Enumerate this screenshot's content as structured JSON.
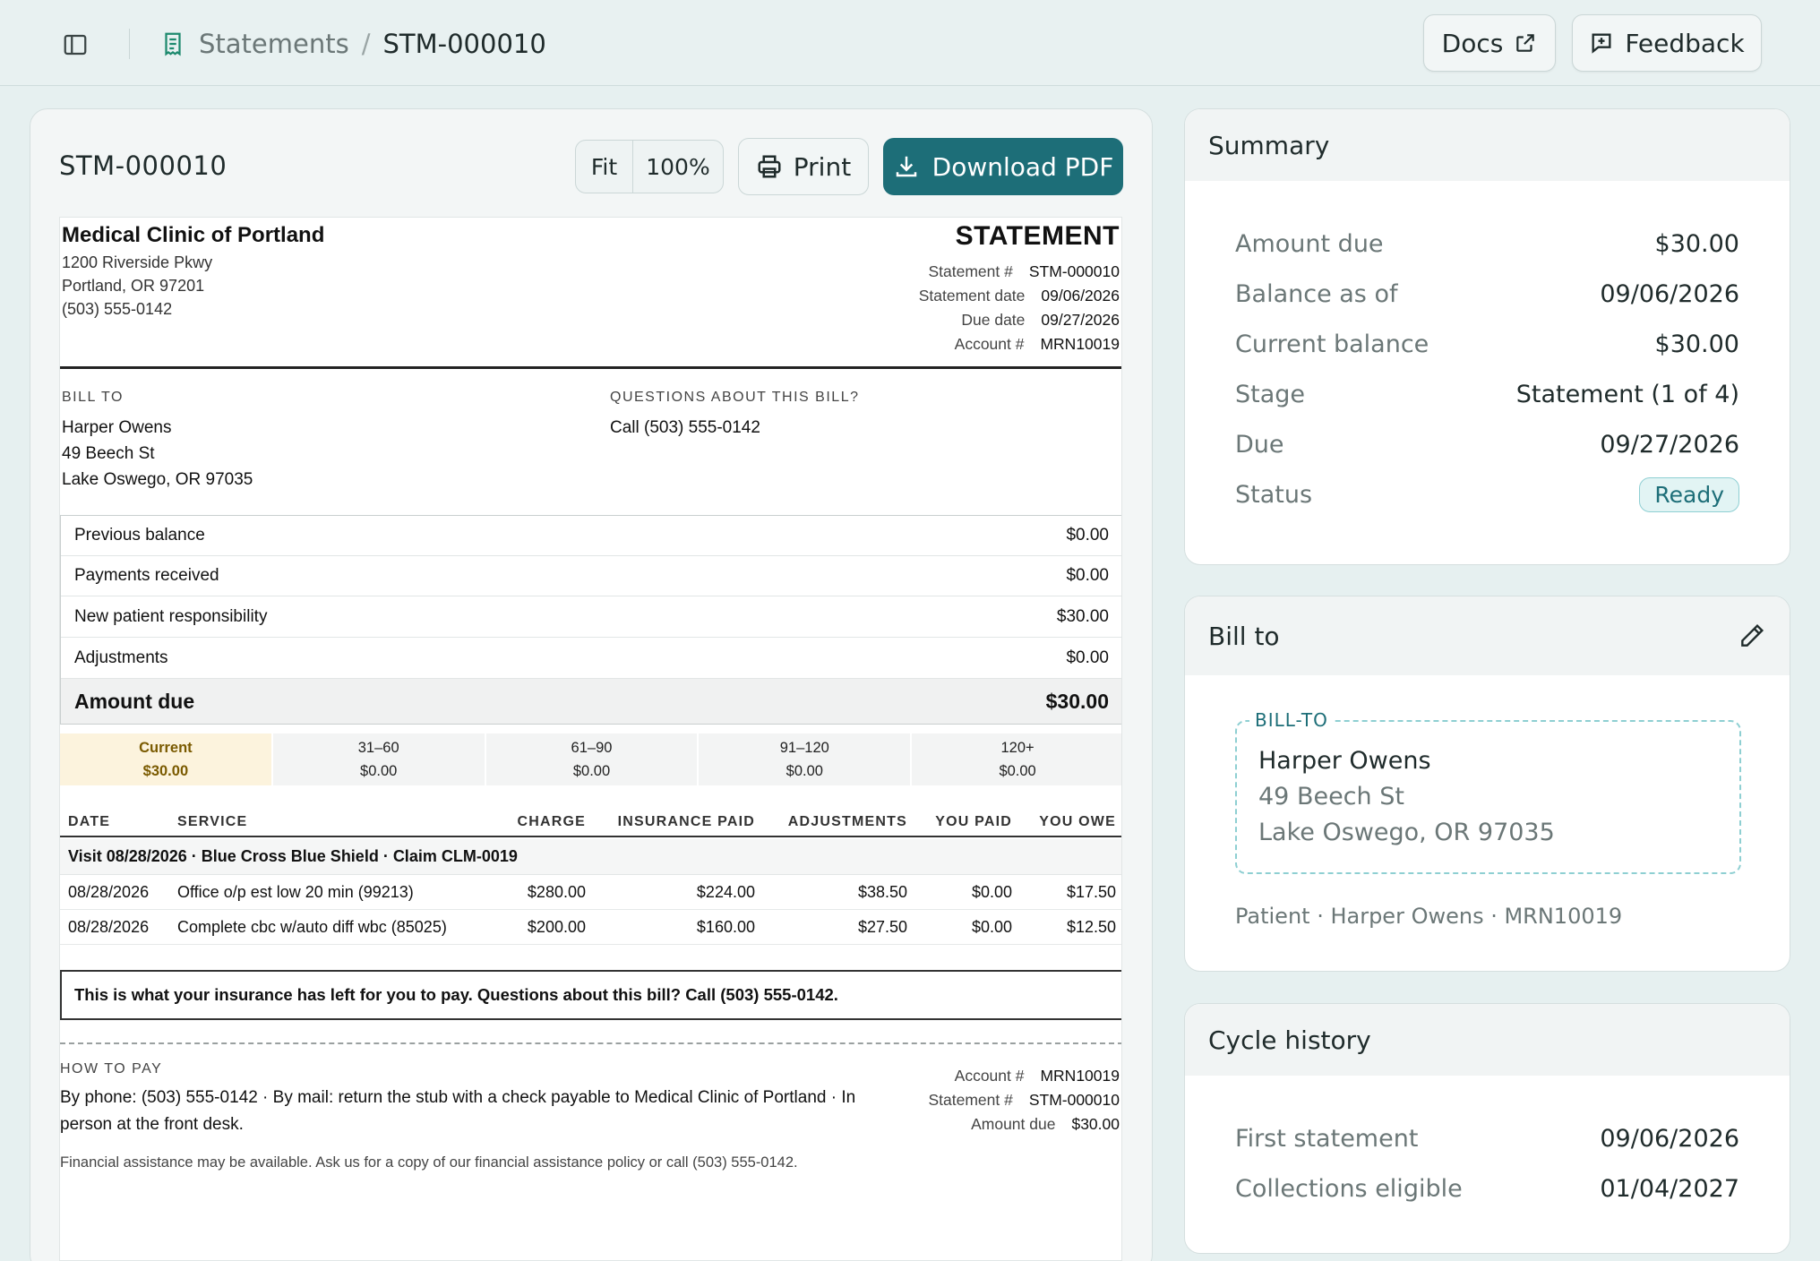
{
  "breadcrumb": {
    "parent": "Statements",
    "separator": "/",
    "current": "STM-000010"
  },
  "header_actions": {
    "docs_label": "Docs",
    "feedback_label": "Feedback"
  },
  "viewer": {
    "title": "STM-000010",
    "zoom_fit": "Fit",
    "zoom_level": "100%",
    "print_label": "Print",
    "download_label": "Download PDF"
  },
  "statement": {
    "clinic": {
      "name": "Medical Clinic of Portland",
      "address1": "1200 Riverside Pkwy",
      "address2": "Portland, OR 97201",
      "phone": "(503) 555-0142"
    },
    "heading": "STATEMENT",
    "meta": [
      {
        "label": "Statement #",
        "value": "STM-000010"
      },
      {
        "label": "Statement date",
        "value": "09/06/2026"
      },
      {
        "label": "Due date",
        "value": "09/27/2026"
      },
      {
        "label": "Account #",
        "value": "MRN10019"
      }
    ],
    "bill_to_label": "BILL TO",
    "bill_to": {
      "name": "Harper Owens",
      "street": "49 Beech St",
      "city": "Lake Oswego, OR 97035"
    },
    "questions_label": "QUESTIONS ABOUT THIS BILL?",
    "questions_text": "Call (503) 555-0142",
    "summary_rows": [
      {
        "label": "Previous balance",
        "value": "$0.00"
      },
      {
        "label": "Payments received",
        "value": "$0.00"
      },
      {
        "label": "New patient responsibility",
        "value": "$30.00"
      },
      {
        "label": "Adjustments",
        "value": "$0.00"
      }
    ],
    "amount_due_label": "Amount due",
    "amount_due_value": "$30.00",
    "aging": [
      {
        "label": "Current",
        "value": "$30.00"
      },
      {
        "label": "31–60",
        "value": "$0.00"
      },
      {
        "label": "61–90",
        "value": "$0.00"
      },
      {
        "label": "91–120",
        "value": "$0.00"
      },
      {
        "label": "120+",
        "value": "$0.00"
      }
    ],
    "columns": [
      "DATE",
      "SERVICE",
      "CHARGE",
      "INSURANCE PAID",
      "ADJUSTMENTS",
      "YOU PAID",
      "YOU OWE"
    ],
    "visit_header": "Visit 08/28/2026 · Blue Cross Blue Shield · Claim CLM-0019",
    "line_items": [
      {
        "date": "08/28/2026",
        "service": "Office o/p est low 20 min (99213)",
        "charge": "$280.00",
        "insurance_paid": "$224.00",
        "adjustments": "$38.50",
        "you_paid": "$0.00",
        "you_owe": "$17.50"
      },
      {
        "date": "08/28/2026",
        "service": "Complete cbc w/auto diff wbc (85025)",
        "charge": "$200.00",
        "insurance_paid": "$160.00",
        "adjustments": "$27.50",
        "you_paid": "$0.00",
        "you_owe": "$12.50"
      }
    ],
    "callout": "This is what your insurance has left for you to pay. Questions about this bill? Call (503) 555-0142.",
    "how_to_pay_label": "HOW TO PAY",
    "how_to_pay_text": "By phone: (503) 555-0142 · By mail: return the stub with a check payable to Medical Clinic of Portland · In person at the front desk.",
    "stub": [
      {
        "label": "Account #",
        "value": "MRN10019"
      },
      {
        "label": "Statement #",
        "value": "STM-000010"
      },
      {
        "label": "Amount due",
        "value": "$30.00"
      }
    ],
    "financial_note": "Financial assistance may be available. Ask us for a copy of our financial assistance policy or call (503) 555-0142."
  },
  "summary_card": {
    "title": "Summary",
    "rows": [
      {
        "label": "Amount due",
        "value": "$30.00"
      },
      {
        "label": "Balance as of",
        "value": "09/06/2026"
      },
      {
        "label": "Current balance",
        "value": "$30.00"
      },
      {
        "label": "Stage",
        "value": "Statement (1 of 4)"
      },
      {
        "label": "Due",
        "value": "09/27/2026"
      }
    ],
    "status_label": "Status",
    "status_value": "Ready"
  },
  "billto_card": {
    "title": "Bill to",
    "legend": "BILL-TO",
    "name": "Harper Owens",
    "street": "49 Beech St",
    "city": "Lake Oswego, OR 97035",
    "patient_line": "Patient · Harper Owens · MRN10019"
  },
  "cycle_card": {
    "title": "Cycle history",
    "rows": [
      {
        "label": "First statement",
        "value": "09/06/2026"
      },
      {
        "label": "Collections eligible",
        "value": "01/04/2027"
      }
    ]
  },
  "colors": {
    "accent": "#1d6e78",
    "background": "#e6f0f0",
    "current_aging_bg": "#fcf3dd"
  },
  "icons": [
    "sidebar-toggle-icon",
    "receipt-icon",
    "external-link-icon",
    "feedback-icon",
    "printer-icon",
    "download-icon",
    "pencil-icon"
  ]
}
